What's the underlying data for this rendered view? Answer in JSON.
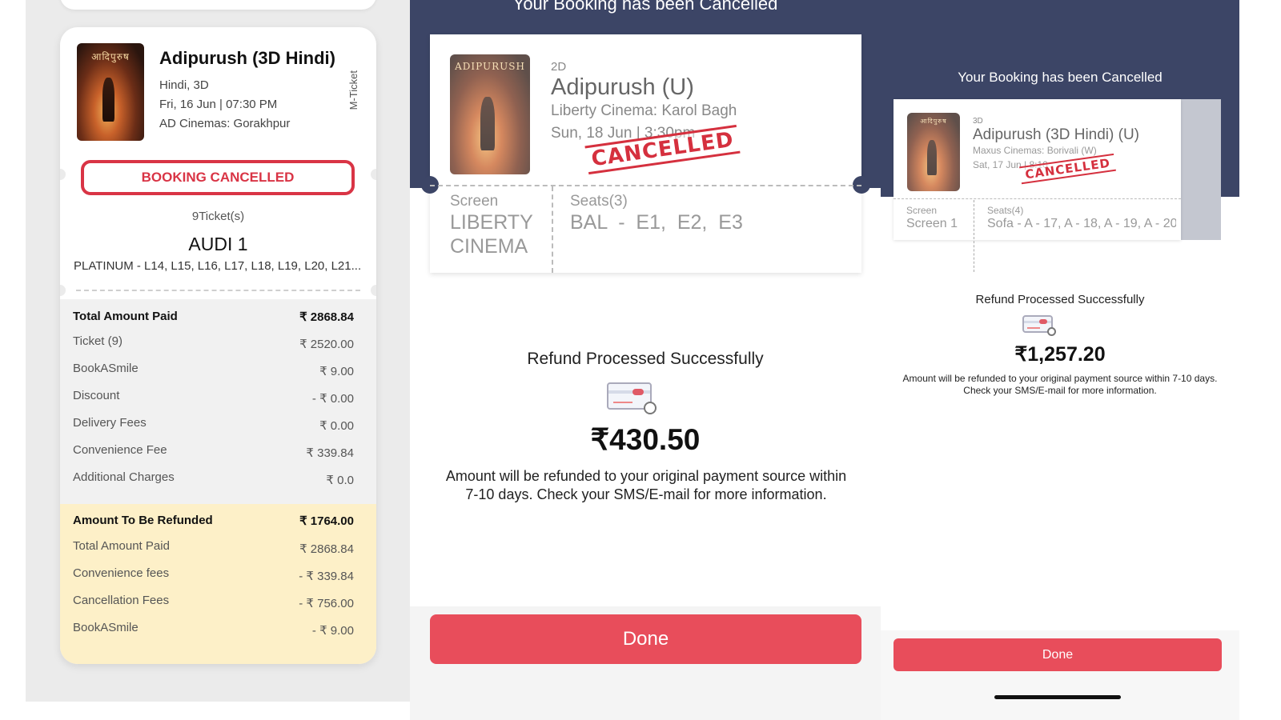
{
  "panel1": {
    "ticket_type": "M-Ticket",
    "movie": {
      "poster_text": "आदिपुरुष",
      "title": "Adipurush (3D Hindi)",
      "language_format": "Hindi, 3D",
      "showtime": "Fri, 16 Jun | 07:30 PM",
      "cinema": "AD Cinemas: Gorakhpur"
    },
    "status": "BOOKING CANCELLED",
    "ticket_count": "9Ticket(s)",
    "screen": "AUDI 1",
    "seats": "PLATINUM - L14, L15, L16, L17, L18, L19, L20, L21...",
    "total": {
      "label": "Total Amount Paid",
      "value": "₹ 2868.84"
    },
    "charges": [
      {
        "label": "Ticket (9)",
        "value": "₹ 2520.00"
      },
      {
        "label": "BookASmile",
        "value": "₹ 9.00"
      },
      {
        "label": "Discount",
        "value": "- ₹ 0.00"
      },
      {
        "label": "Delivery Fees",
        "value": "₹ 0.00"
      },
      {
        "label": "Convenience Fee",
        "value": "₹ 339.84"
      },
      {
        "label": "Additional Charges",
        "value": "₹ 0.0"
      }
    ],
    "refund_total": {
      "label": "Amount To Be Refunded",
      "value": "₹ 1764.00"
    },
    "refund_breakdown": [
      {
        "label": "Total Amount Paid",
        "value": "₹ 2868.84"
      },
      {
        "label": "Convenience fees",
        "value": "- ₹ 339.84"
      },
      {
        "label": "Cancellation Fees",
        "value": "- ₹ 756.00"
      },
      {
        "label": "BookASmile",
        "value": "- ₹ 9.00"
      }
    ]
  },
  "panel2": {
    "header_title": "Your Booking has been Cancelled",
    "poster_text": "ADIPURUSH",
    "format": "2D",
    "title": "Adipurush (U)",
    "cinema": "Liberty Cinema: Karol Bagh",
    "showtime": "Sun, 18 Jun | 3:30pm",
    "stamp": "CANCELLED",
    "screen_label": "Screen",
    "screen_value_1": "LIBERTY",
    "screen_value_2": "CINEMA",
    "seats_label": "Seats(3)",
    "seats_value": "BAL  -  E1,  E2,  E3",
    "refund_title": "Refund Processed Successfully",
    "refund_amount": "₹430.50",
    "refund_note": "Amount will be refunded to your original payment source within 7-10 days. Check your SMS/E-mail for more information.",
    "done_label": "Done"
  },
  "panel3": {
    "header_title": "Your Booking has been Cancelled",
    "poster_text": "आदिपुरुष",
    "format": "3D",
    "title": "Adipurush (3D Hindi) (U)",
    "cinema": "Maxus Cinemas: Borivali (W)",
    "showtime": "Sat, 17 Jun | 8:10",
    "stamp": "CANCELLED",
    "screen_label": "Screen",
    "screen_value": "Screen 1",
    "seats_label": "Seats(4)",
    "seats_value": "Sofa - A - 17, A - 18, A - 19, A - 20",
    "refund_title": "Refund Processed Successfully",
    "refund_amount": "₹1,257.20",
    "refund_note": "Amount will be refunded to your original payment source within 7-10 days. Check your SMS/E-mail for more information.",
    "done_label": "Done"
  },
  "colors": {
    "header_navy": "#3c4566",
    "accent_red": "#e84d5b",
    "stamp_red": "#d5303e",
    "refund_bg": "#fdf0c8"
  },
  "icons": [
    "refund-card-icon"
  ]
}
